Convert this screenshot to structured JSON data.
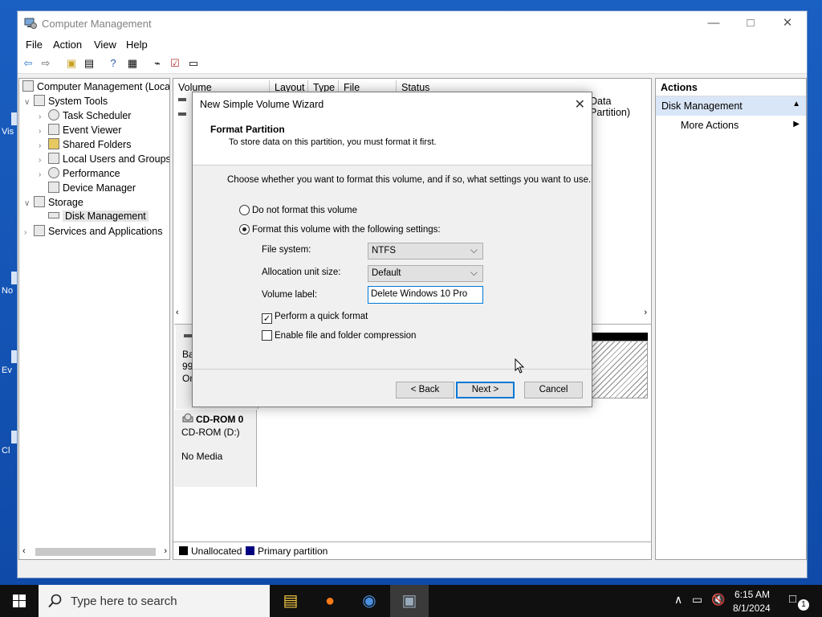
{
  "window": {
    "title": "Computer Management",
    "menu": [
      "File",
      "Action",
      "View",
      "Help"
    ]
  },
  "desktop_labels": [
    "Vis",
    "No",
    "Ev",
    "Cl"
  ],
  "tree": {
    "root": "Computer Management (Local",
    "system_tools": "System Tools",
    "task_scheduler": "Task Scheduler",
    "event_viewer": "Event Viewer",
    "shared_folders": "Shared Folders",
    "local_users": "Local Users and Groups",
    "performance": "Performance",
    "device_manager": "Device Manager",
    "storage": "Storage",
    "disk_management": "Disk Management",
    "services": "Services and Applications"
  },
  "volume_list": {
    "columns": [
      "Volume",
      "Layout",
      "Type",
      "File System",
      "Status"
    ],
    "partial_status": "Data Partition)"
  },
  "disk_panel": {
    "disk_partial": [
      "Ba",
      "99",
      "On"
    ],
    "cdrom_name": "CD-ROM 0",
    "cdrom_type": "CD-ROM (D:)",
    "cdrom_media": "No Media"
  },
  "legend": {
    "unallocated": "Unallocated",
    "primary": "Primary partition",
    "unallocated_color": "#000000",
    "primary_color": "#00007f"
  },
  "actions": {
    "header": "Actions",
    "section": "Disk Management",
    "more": "More Actions"
  },
  "wizard": {
    "title": "New Simple Volume Wizard",
    "heading": "Format Partition",
    "subheading": "To store data on this partition, you must format it first.",
    "instruction": "Choose whether you want to format this volume, and if so, what settings you want to use.",
    "opt_no_format": "Do not format this volume",
    "opt_format": "Format this volume with the following settings:",
    "fs_label": "File system:",
    "fs_value": "NTFS",
    "alloc_label": "Allocation unit size:",
    "alloc_value": "Default",
    "vol_label": "Volume label:",
    "vol_value": "Delete Windows 10 Pro",
    "quick_format": "Perform a quick format",
    "compression": "Enable file and folder compression",
    "back": "< Back",
    "next": "Next >",
    "cancel": "Cancel",
    "quick_format_checked": true,
    "compression_checked": false
  },
  "taskbar": {
    "search_placeholder": "Type here to search",
    "time": "6:15 AM",
    "date": "8/1/2024",
    "notification_count": "1"
  }
}
